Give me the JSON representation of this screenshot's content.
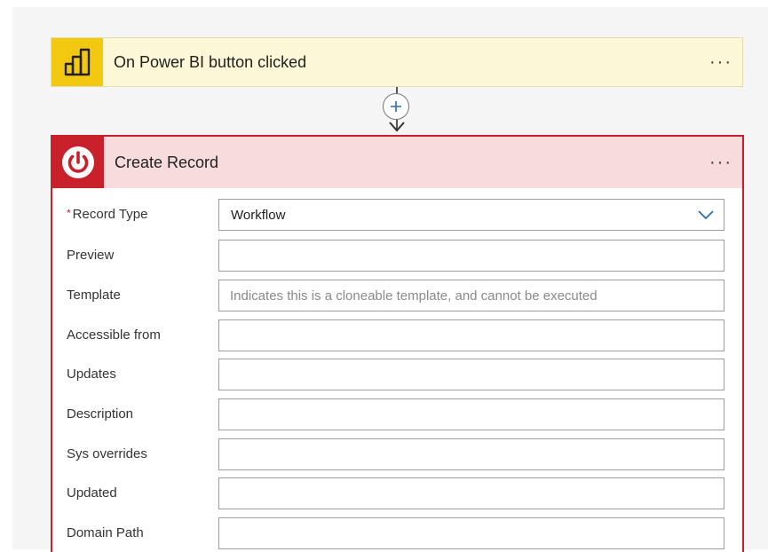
{
  "trigger": {
    "title": "On Power BI button clicked",
    "icon": "power-bi-icon",
    "accent_color": "#f2c811",
    "more_label": "···"
  },
  "connector": {
    "add_icon": "plus-icon",
    "arrow_icon": "arrow-down-icon"
  },
  "action": {
    "title": "Create Record",
    "icon": "power-icon",
    "accent_color": "#c9212b",
    "more_label": "···",
    "fields": [
      {
        "label": "Record Type",
        "required": true,
        "type": "select",
        "value": "Workflow",
        "placeholder": ""
      },
      {
        "label": "Preview",
        "required": false,
        "type": "text",
        "value": "",
        "placeholder": ""
      },
      {
        "label": "Template",
        "required": false,
        "type": "text",
        "value": "",
        "placeholder": "Indicates this is a cloneable template, and cannot be executed"
      },
      {
        "label": "Accessible from",
        "required": false,
        "type": "text",
        "value": "",
        "placeholder": ""
      },
      {
        "label": "Updates",
        "required": false,
        "type": "text",
        "value": "",
        "placeholder": ""
      },
      {
        "label": "Description",
        "required": false,
        "type": "text",
        "value": "",
        "placeholder": ""
      },
      {
        "label": "Sys overrides",
        "required": false,
        "type": "text",
        "value": "",
        "placeholder": ""
      },
      {
        "label": "Updated",
        "required": false,
        "type": "text",
        "value": "",
        "placeholder": ""
      },
      {
        "label": "Domain Path",
        "required": false,
        "type": "text",
        "value": "",
        "placeholder": ""
      }
    ]
  }
}
